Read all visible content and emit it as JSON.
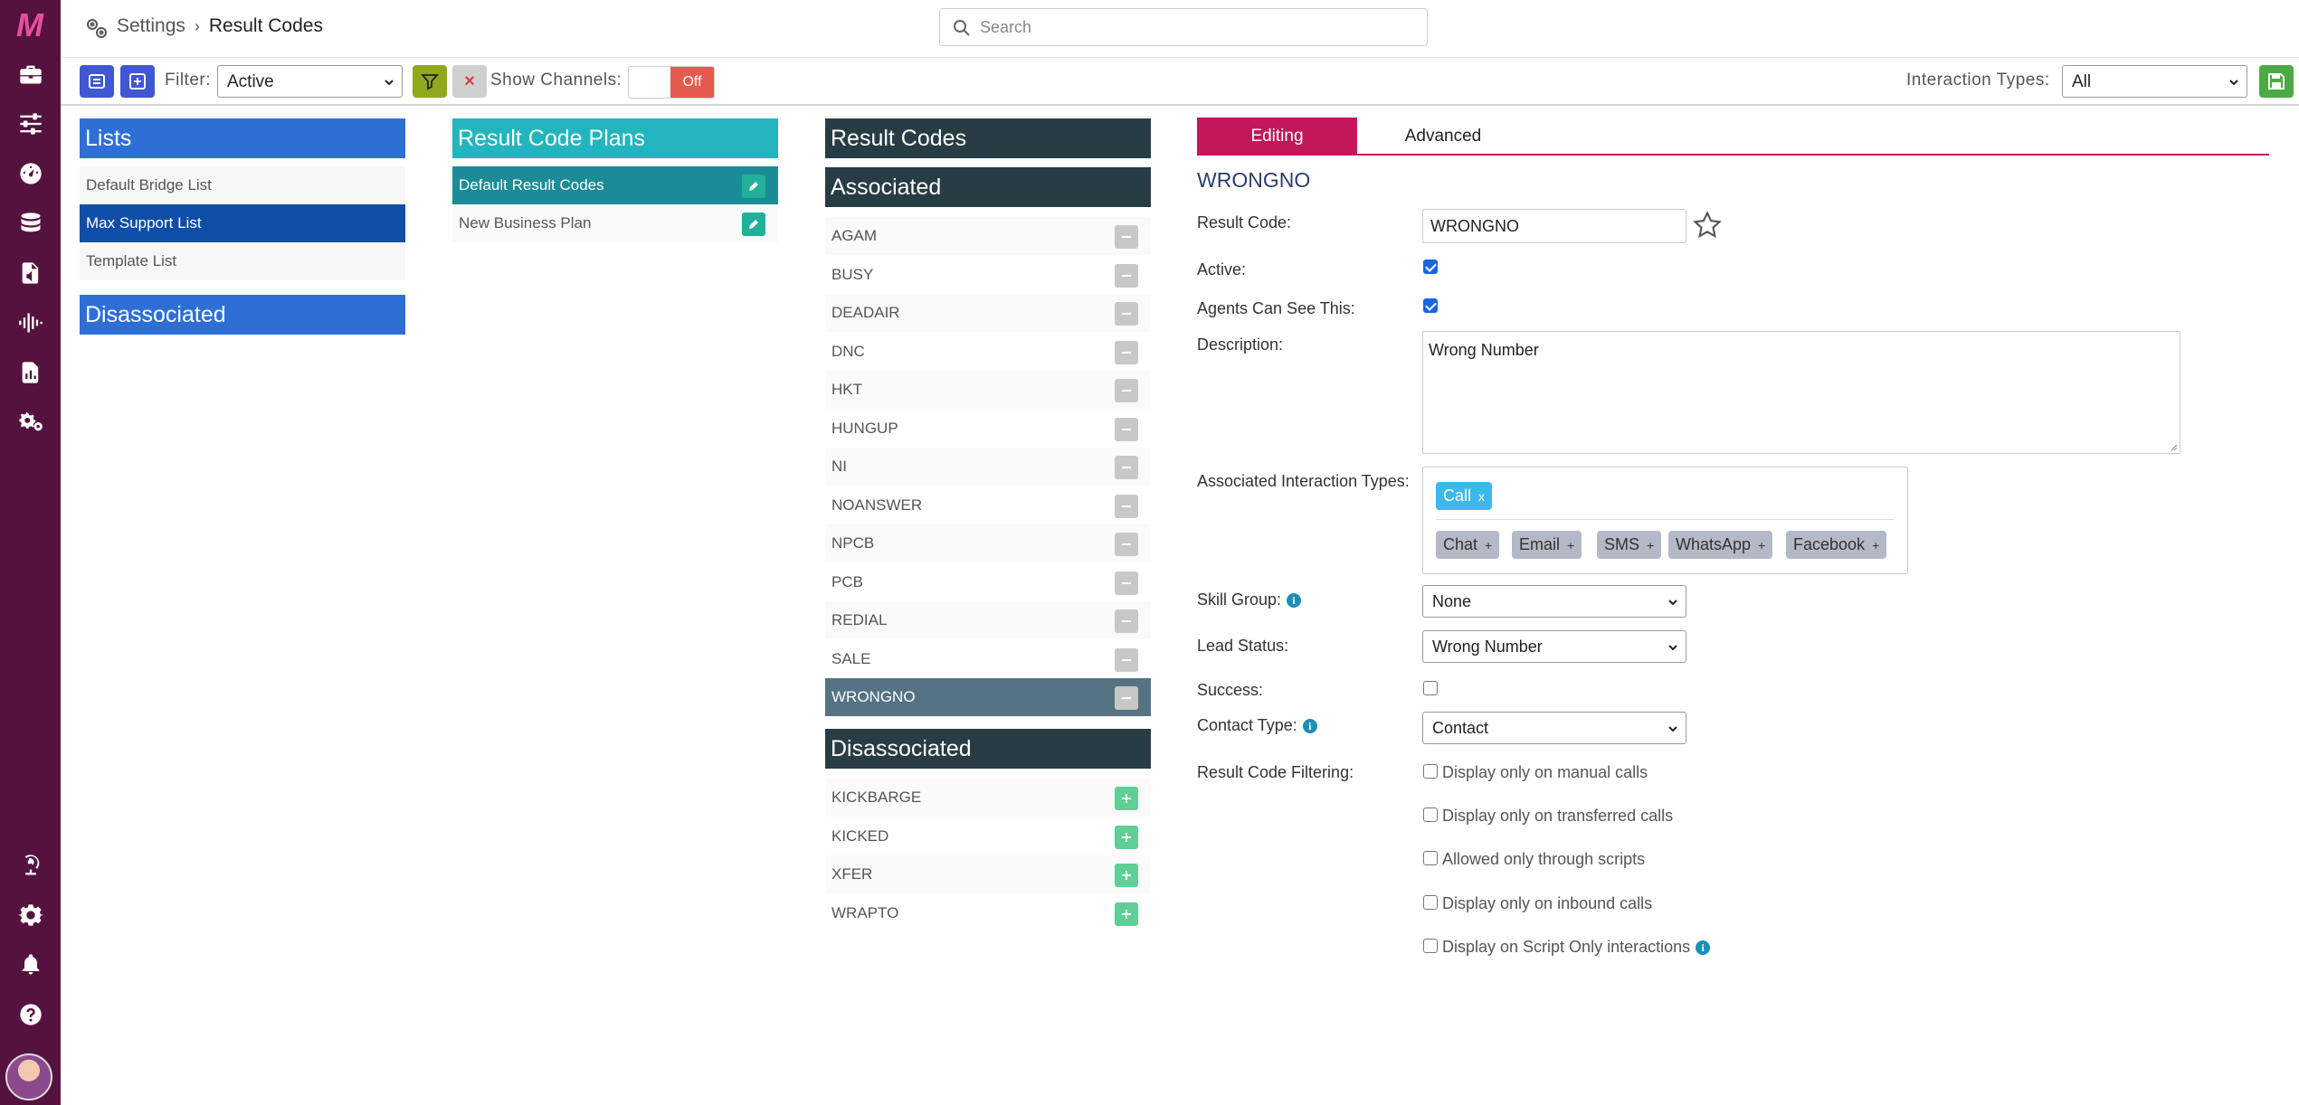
{
  "nav": {
    "logo": "M",
    "icons": [
      "briefcase-icon",
      "sliders-icon",
      "dashboard-icon",
      "database-icon",
      "file-audio-icon",
      "waveform-icon",
      "report-icon",
      "cogs-icon",
      "globe-icon",
      "gear-icon",
      "bell-icon",
      "help-icon"
    ]
  },
  "header": {
    "breadcrumb_root": "Settings",
    "breadcrumb_current": "Result Codes",
    "search_placeholder": "Search"
  },
  "toolbar": {
    "filter_label": "Filter:",
    "filter_value": "Active",
    "clear_label": "×",
    "show_channels_label": "Show Channels:",
    "toggle_off_label": "Off",
    "interaction_types_label": "Interaction Types:",
    "interaction_types_value": "All"
  },
  "lists": {
    "title": "Lists",
    "items": [
      "Default Bridge List",
      "Max Support List",
      "Template List"
    ],
    "selected": "Max Support List",
    "disassociated_title": "Disassociated"
  },
  "plans": {
    "title": "Result Code Plans",
    "items": [
      "Default Result Codes",
      "New Business Plan"
    ],
    "selected": "Default Result Codes"
  },
  "codes": {
    "title": "Result Codes",
    "associated_title": "Associated",
    "associated": [
      "AGAM",
      "BUSY",
      "DEADAIR",
      "DNC",
      "HKT",
      "HUNGUP",
      "NI",
      "NOANSWER",
      "NPCB",
      "PCB",
      "REDIAL",
      "SALE",
      "WRONGNO"
    ],
    "selected": "WRONGNO",
    "disassociated_title": "Disassociated",
    "disassociated": [
      "KICKBARGE",
      "KICKED",
      "XFER",
      "WRAPTO"
    ]
  },
  "editor": {
    "tab_editing": "Editing",
    "tab_advanced": "Advanced",
    "title": "WRONGNO",
    "result_code_label": "Result Code:",
    "result_code_value": "WRONGNO",
    "active_label": "Active:",
    "active_checked": true,
    "agents_label": "Agents Can See This:",
    "agents_checked": true,
    "description_label": "Description:",
    "description_value": "Wrong Number",
    "assoc_types_label": "Associated Interaction Types:",
    "selected_types": [
      "Call"
    ],
    "available_types": [
      "Chat",
      "Email",
      "SMS",
      "WhatsApp",
      "Facebook"
    ],
    "skill_group_label": "Skill Group:",
    "skill_group_value": "None",
    "lead_status_label": "Lead Status:",
    "lead_status_value": "Wrong Number",
    "success_label": "Success:",
    "success_checked": false,
    "contact_type_label": "Contact Type:",
    "contact_type_value": "Contact",
    "filtering_label": "Result Code Filtering:",
    "filtering_options": [
      "Display only on manual calls",
      "Display only on transferred calls",
      "Allowed only through scripts",
      "Display only on inbound calls",
      "Display on Script Only interactions"
    ]
  },
  "colors": {
    "nav_bg": "#55123f",
    "lists_header": "#2e6fd6",
    "plans_header": "#22b5bf",
    "codes_header": "#283c45",
    "accent_tab": "#c2185b",
    "selected_list_row": "#0f4ea6",
    "selected_plan_row": "#1b8c97",
    "selected_code_row": "#557382"
  }
}
